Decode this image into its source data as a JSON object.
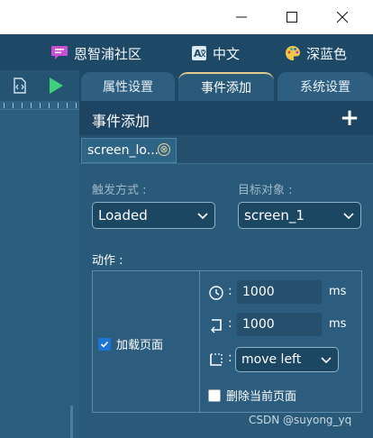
{
  "window": {
    "controls": [
      "minimize",
      "maximize",
      "close"
    ]
  },
  "topbar": {
    "community": {
      "label": "恩智浦社区",
      "icon": "chat-bubble-icon",
      "color": "#c94fd6"
    },
    "language": {
      "label": "中文",
      "icon": "translate-icon"
    },
    "theme": {
      "label": "深蓝色",
      "icon": "palette-icon"
    }
  },
  "left_toolbar": {
    "icons": [
      "code-file-icon",
      "play-icon"
    ]
  },
  "tabs": [
    {
      "label": "属性设置",
      "active": false
    },
    {
      "label": "事件添加",
      "active": true
    },
    {
      "label": "系统设置",
      "active": false
    }
  ],
  "panel": {
    "title": "事件添加",
    "add_symbol": "+",
    "event_tab": {
      "label": "screen_lo...",
      "close_symbol": "⊗"
    },
    "trigger": {
      "label": "触发方式 :",
      "value": "Loaded"
    },
    "target": {
      "label": "目标对象 :",
      "value": "screen_1"
    },
    "actions_label": "动作 :",
    "load_page": {
      "label": "加载页面",
      "checked": true
    },
    "delay": {
      "value": "1000",
      "unit": "ms",
      "colon": ":"
    },
    "duration": {
      "value": "1000",
      "unit": "ms",
      "colon": ":"
    },
    "animation": {
      "value": "move left",
      "colon": ":"
    },
    "delete_current": {
      "label": "删除当前页面",
      "checked": false
    }
  },
  "watermark": "CSDN @suyong_yq",
  "colors": {
    "accent": "#e2c98c",
    "checkbox": "#1e73d6",
    "background": "#1f4a66"
  }
}
